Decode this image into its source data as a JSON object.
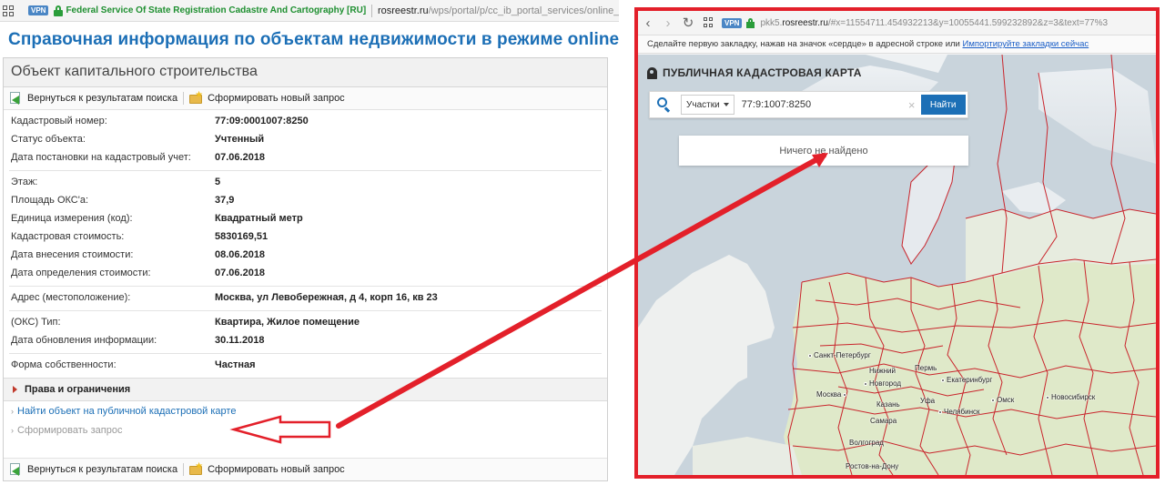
{
  "left": {
    "browser": {
      "vpn_label": "VPN",
      "site_name": "Federal Service Of State Registration Cadastre And Cartography [RU]",
      "url_host": "rosreestr.ru",
      "url_path": "/wps/portal/p/cc_ib_portal_services/online_request/ut/"
    },
    "page_title": "Справочная информация по объектам недвижимости в режиме online",
    "card_title": "Объект капитального строительства",
    "toolbar": {
      "back_label": "Вернуться к результатам поиска",
      "new_query_label": "Сформировать новый запрос"
    },
    "groups": [
      [
        {
          "key": "Кадастровый номер:",
          "value": "77:09:0001007:8250"
        },
        {
          "key": "Статус объекта:",
          "value": "Учтенный"
        },
        {
          "key": "Дата постановки на кадастровый учет:",
          "value": "07.06.2018"
        }
      ],
      [
        {
          "key": "Этаж:",
          "value": "5"
        },
        {
          "key": "Площадь ОКС'a:",
          "value": "37,9"
        },
        {
          "key": "Единица измерения (код):",
          "value": "Квадратный метр"
        },
        {
          "key": "Кадастровая стоимость:",
          "value": "5830169,51"
        },
        {
          "key": "Дата внесения стоимости:",
          "value": "08.06.2018"
        },
        {
          "key": "Дата определения стоимости:",
          "value": "07.06.2018"
        }
      ],
      [
        {
          "key": "Адрес (местоположение):",
          "value": "Москва, ул Левобережная, д 4, корп 16, кв 23"
        }
      ],
      [
        {
          "key": "(ОКС) Тип:",
          "value": "Квартира, Жилое помещение"
        },
        {
          "key": "Дата обновления информации:",
          "value": "30.11.2018"
        }
      ],
      [
        {
          "key": "Форма собственности:",
          "value": "Частная"
        }
      ]
    ],
    "rights_label": "Права и ограничения",
    "find_on_map_link": "Найти объект на публичной кадастровой карте",
    "form_request_link": "Сформировать запрос"
  },
  "right": {
    "browser": {
      "back_glyph": "‹",
      "forward_glyph": "›",
      "reload_glyph": "↻",
      "vpn_label": "VPN",
      "url_host_prefix": "pkk5.",
      "url_host": "rosreestr.ru",
      "url_path": "/#x=11554711.454932213&y=10055441.599232892&z=3&text=77%3"
    },
    "bookmarks_text": "Сделайте первую закладку, нажав на значок «сердце» в адресной строке или",
    "bookmarks_link": "Импортируйте закладки сейчас",
    "map_logo": "ПУБЛИЧНАЯ КАДАСТРОВАЯ КАРТА",
    "search": {
      "type_label": "Участки",
      "value": "77:9:1007:8250",
      "clear_glyph": "×",
      "button_label": "Найти"
    },
    "no_result": "Ничего не найдено",
    "cities": [
      "Санкт-Петербург",
      "Нижний",
      "Новгород",
      "Пермь",
      "Екатеринбург",
      "Москва",
      "Казань",
      "Уфа",
      "Челябинск",
      "Омск",
      "Новосибирск",
      "Самара",
      "Волгоград",
      "Ростов-на-Дону"
    ]
  },
  "colors": {
    "heading_blue": "#1c6fb6",
    "highlight_red": "#e3202a",
    "map_sea": "#c9d4dc",
    "map_land_green": "#dfe9c9",
    "boundary_red": "#c9252c"
  }
}
